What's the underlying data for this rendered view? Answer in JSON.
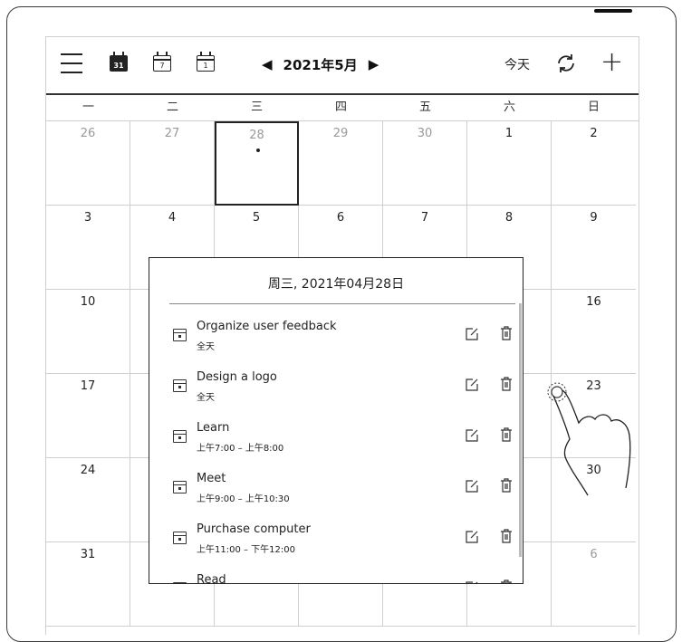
{
  "toolbar": {
    "menu_icon": "hamburger-menu-icon",
    "month_view_icon_num": "31",
    "week_view_icon_num": "7",
    "day_view_icon_num": "1",
    "prev_icon": "◀",
    "month_label": "2021年5月",
    "next_icon": "▶",
    "today_label": "今天",
    "sync_icon": "sync-icon",
    "add_icon": "+"
  },
  "weekdays": [
    "一",
    "二",
    "三",
    "四",
    "五",
    "六",
    "日"
  ],
  "weeks": [
    [
      {
        "d": "26",
        "muted": true
      },
      {
        "d": "27",
        "muted": true
      },
      {
        "d": "28",
        "muted": true,
        "selected": true,
        "dot": true
      },
      {
        "d": "29",
        "muted": true
      },
      {
        "d": "30",
        "muted": true
      },
      {
        "d": "1"
      },
      {
        "d": "2"
      }
    ],
    [
      {
        "d": "3"
      },
      {
        "d": "4"
      },
      {
        "d": "5"
      },
      {
        "d": "6"
      },
      {
        "d": "7"
      },
      {
        "d": "8"
      },
      {
        "d": "9"
      }
    ],
    [
      {
        "d": "10"
      },
      {
        "d": ""
      },
      {
        "d": ""
      },
      {
        "d": ""
      },
      {
        "d": ""
      },
      {
        "d": ""
      },
      {
        "d": "16"
      }
    ],
    [
      {
        "d": "17"
      },
      {
        "d": ""
      },
      {
        "d": ""
      },
      {
        "d": ""
      },
      {
        "d": ""
      },
      {
        "d": ""
      },
      {
        "d": "23"
      }
    ],
    [
      {
        "d": "24"
      },
      {
        "d": ""
      },
      {
        "d": ""
      },
      {
        "d": ""
      },
      {
        "d": ""
      },
      {
        "d": ""
      },
      {
        "d": "30"
      }
    ],
    [
      {
        "d": "31"
      },
      {
        "d": ""
      },
      {
        "d": ""
      },
      {
        "d": ""
      },
      {
        "d": ""
      },
      {
        "d": ""
      },
      {
        "d": "6",
        "muted": true
      }
    ]
  ],
  "popup": {
    "title": "周三, 2021年04月28日",
    "events": [
      {
        "title": "Organize user feedback",
        "time": "全天"
      },
      {
        "title": "Design a logo",
        "time": "全天"
      },
      {
        "title": "Learn",
        "time": "上午7:00 – 上午8:00"
      },
      {
        "title": "Meet",
        "time": "上午9:00 – 上午10:30"
      },
      {
        "title": "Purchase computer",
        "time": "上午11:00 – 下午12:00"
      },
      {
        "title": "Read",
        "time": ""
      }
    ],
    "event_icon": "calendar-event-icon",
    "edit_icon": "edit-icon",
    "delete_icon": "trash-icon"
  }
}
